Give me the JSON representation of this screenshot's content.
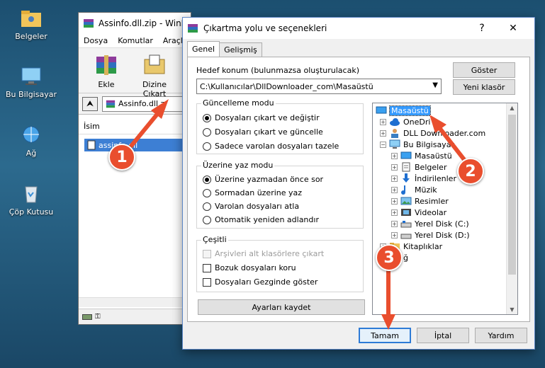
{
  "desktop": {
    "icons": [
      {
        "label": "Belgeler"
      },
      {
        "label": "Bu Bilgisayar"
      },
      {
        "label": "Ağ"
      },
      {
        "label": "Çöp Kutusu"
      }
    ]
  },
  "winrar": {
    "title": "Assinfo.dll.zip - WinR",
    "menu": [
      "Dosya",
      "Komutlar",
      "Araçlar"
    ],
    "toolbar": [
      "Ekle",
      "Dizine Çıkart"
    ],
    "path": "Assinfo.dll.z",
    "column": "İsim",
    "file": "assinfo.dll"
  },
  "dialog": {
    "title": "Çıkartma yolu ve seçenekleri",
    "help": "?",
    "close": "✕",
    "tabs": [
      "Genel",
      "Gelişmiş"
    ],
    "dest_label": "Hedef konum (bulunmazsa oluşturulacak)",
    "dest_value": "C:\\Kullanıcılar\\DllDownloader_com\\Masaüstü",
    "show_button": "Göster",
    "new_folder_button": "Yeni klasör",
    "update_mode": {
      "title": "Güncelleme modu",
      "options": [
        "Dosyaları çıkart ve değiştir",
        "Dosyaları çıkart ve güncelle",
        "Sadece varolan dosyaları tazele"
      ],
      "selected": 0
    },
    "overwrite_mode": {
      "title": "Üzerine yaz modu",
      "options": [
        "Üzerine yazmadan önce sor",
        "Sormadan üzerine yaz",
        "Varolan dosyaları atla",
        "Otomatik yeniden adlandır"
      ],
      "selected": 0
    },
    "misc": {
      "title": "Çeşitli",
      "options": [
        "Arşivleri alt klasörlere çıkart",
        "Bozuk dosyaları koru",
        "Dosyaları Gezginde göster"
      ],
      "disabled": [
        true,
        false,
        false
      ]
    },
    "save_settings": "Ayarları kaydet",
    "tree": [
      {
        "label": "Masaüstü",
        "selected": true
      },
      {
        "label": "OneDri"
      },
      {
        "label": "DLL Downloader.com"
      },
      {
        "label": "Bu Bilgisayar"
      },
      {
        "label": "Masaüstü"
      },
      {
        "label": "Belgeler"
      },
      {
        "label": "İndirilenler"
      },
      {
        "label": "Müzik"
      },
      {
        "label": "Resimler"
      },
      {
        "label": "Videolar"
      },
      {
        "label": "Yerel Disk (C:)"
      },
      {
        "label": "Yerel Disk (D:)"
      },
      {
        "label": "Kitaplıklar"
      },
      {
        "label": "ğ"
      }
    ],
    "ok": "Tamam",
    "cancel": "İptal",
    "helpbtn": "Yardım"
  },
  "markers": [
    "1",
    "2",
    "3"
  ],
  "colors": {
    "marker": "#e94e2e",
    "selection": "#3399ff",
    "accent": "#2e7bd6"
  }
}
